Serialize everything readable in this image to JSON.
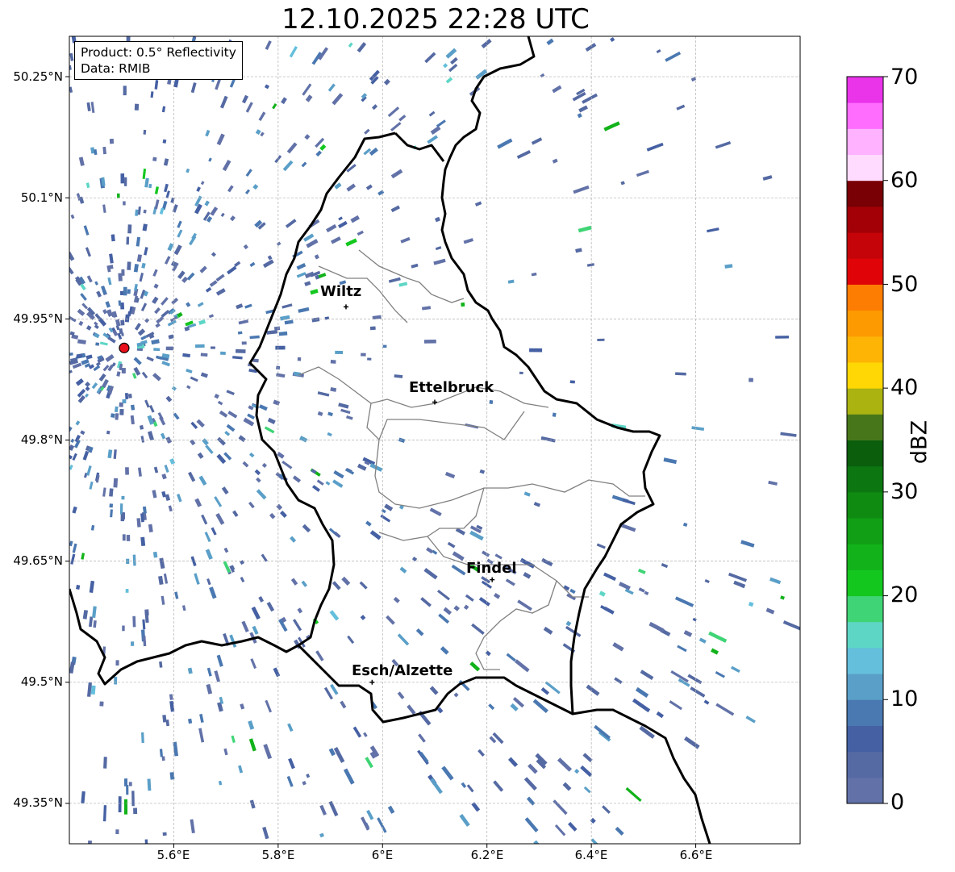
{
  "title": "12.10.2025 22:28 UTC",
  "info_box": {
    "product": "Product: 0.5° Reflectivity",
    "source": "Data: RMIB"
  },
  "latitude_labels": [
    "50.25°N",
    "50.1°N",
    "49.95°N",
    "49.8°N",
    "49.65°N",
    "49.5°N",
    "49.35°N"
  ],
  "longitude_labels": [
    "5.6°E",
    "5.8°E",
    "6°E",
    "6.2°E",
    "6.4°E",
    "6.6°E"
  ],
  "map_extent": {
    "lon_range": [
      5.4,
      6.8
    ],
    "lat_range": [
      49.3,
      50.3
    ]
  },
  "cities": [
    {
      "name": "Wiltz",
      "lon": 5.93,
      "lat": 49.965
    },
    {
      "name": "Ettelbruck",
      "lon": 6.1,
      "lat": 49.847
    },
    {
      "name": "Findel",
      "lon": 6.21,
      "lat": 49.627
    },
    {
      "name": "Esch/Alzette",
      "lon": 5.98,
      "lat": 49.5
    }
  ],
  "radar_site": {
    "lon": 5.505,
    "lat": 49.914
  },
  "colorbar": {
    "label": "dBZ",
    "ticks": [
      "70",
      "60",
      "50",
      "40",
      "30",
      "20",
      "10",
      "0"
    ],
    "range": [
      0,
      70
    ],
    "step": 2.5,
    "colors": [
      "#6272a8",
      "#556aa3",
      "#4560a3",
      "#4a78b1",
      "#5a9fc8",
      "#64bfdc",
      "#5ed6c6",
      "#3fd475",
      "#14c71f",
      "#12b21a",
      "#119f15",
      "#0f8b11",
      "#0c7710",
      "#0a5e0c",
      "#47761a",
      "#aab310",
      "#fed704",
      "#fdb404",
      "#fd9a02",
      "#fd7c02",
      "#e00408",
      "#c40409",
      "#a20006",
      "#790005",
      "#ffdcff",
      "#ffb2ff",
      "#ff6dff",
      "#ea34ea"
    ]
  },
  "colors": {
    "country_border": "#000000",
    "district_border": "#808080",
    "grid": "#b0b0b0",
    "radar_echo": "#5a73a8",
    "radar_marker": "#e8101a"
  }
}
